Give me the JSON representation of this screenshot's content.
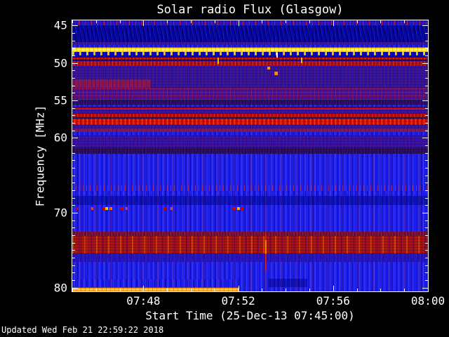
{
  "title": "Solar radio Flux (Glasgow)",
  "updated": "Updated Wed Feb 21 22:59:22 2018",
  "x_axis": {
    "label": "Start Time (25-Dec-13 07:45:00)",
    "minutes_total": 15,
    "major_ticks": [
      {
        "minute": 3,
        "label": "07:48"
      },
      {
        "minute": 7,
        "label": "07:52"
      },
      {
        "minute": 11,
        "label": "07:56"
      },
      {
        "minute": 15,
        "label": "08:00"
      }
    ]
  },
  "y_axis": {
    "label": "Frequency [MHz]",
    "major_ticks": [
      {
        "value": 45,
        "label": "45"
      },
      {
        "value": 50,
        "label": "50"
      },
      {
        "value": 55,
        "label": "55"
      },
      {
        "value": 60,
        "label": "60"
      },
      {
        "value": 70,
        "label": "70"
      },
      {
        "value": 80,
        "label": "80"
      }
    ],
    "minor_step_mhz": 1
  },
  "chart_data": {
    "type": "heatmap",
    "subtype": "radio-spectrogram",
    "title": "Solar radio Flux (Glasgow)",
    "xlabel": "Start Time (25-Dec-13 07:45:00)",
    "ylabel": "Frequency [MHz]",
    "x_range_time": [
      "07:45:00",
      "08:00:00"
    ],
    "y_range_mhz": [
      44.3,
      80.5
    ],
    "y_axis_direction": "increasing-downward",
    "grid": false,
    "legend": "none",
    "palette": {
      "background_quiet": "#1B1BE0",
      "weak": "#3D0F93",
      "moderate": "#BC0E0E",
      "strong": "#FF9800",
      "saturated": "#FFEE58",
      "frame_text": "#FFFFFF"
    },
    "bands": [
      {
        "name": "top-noise-row",
        "f0": 44.3,
        "f1": 45.0,
        "tex": "topnoise"
      },
      {
        "name": "quiet-navy",
        "f0": 45.0,
        "f1": 47.25,
        "tex": "navy"
      },
      {
        "name": "thin-purple-row",
        "f0": 47.25,
        "f1": 47.55,
        "tex": "mauve"
      },
      {
        "name": "pre-yellow-blue",
        "f0": 47.55,
        "f1": 47.9,
        "tex": "blue"
      },
      {
        "name": "saturated-yellow-band",
        "f0": 47.9,
        "f1": 48.55,
        "tex": "yellowband"
      },
      {
        "name": "comb-teeth-band",
        "f0": 48.55,
        "f1": 49.3,
        "tex": "teeth"
      },
      {
        "name": "red-line-49",
        "f0": 49.3,
        "f1": 49.55,
        "tex": "red"
      },
      {
        "name": "gap-navy",
        "f0": 49.55,
        "f1": 49.75,
        "tex": "navy"
      },
      {
        "name": "red-band-50",
        "f0": 49.75,
        "f1": 50.35,
        "tex": "red"
      },
      {
        "name": "purple-mottle-51",
        "f0": 50.35,
        "f1": 52.15,
        "tex": "purple"
      },
      {
        "name": "purple-52",
        "f0": 52.15,
        "f1": 53.35,
        "tex": "purple"
      },
      {
        "name": "red-patch-left-52",
        "f0": 52.15,
        "f1": 53.35,
        "tex": "redsoft",
        "x0": 0,
        "x1": 0.22
      },
      {
        "name": "purple-rows-54",
        "f0": 53.35,
        "f1": 54.9,
        "tex": "purplerows"
      },
      {
        "name": "dark-purple-55",
        "f0": 54.9,
        "f1": 55.55,
        "tex": "darkpurple"
      },
      {
        "name": "blue-row-556",
        "f0": 55.55,
        "f1": 55.85,
        "tex": "blue"
      },
      {
        "name": "red-rows-56",
        "f0": 55.85,
        "f1": 56.25,
        "tex": "redrows"
      },
      {
        "name": "purple-565",
        "f0": 56.25,
        "f1": 56.75,
        "tex": "purple"
      },
      {
        "name": "red-band-57",
        "f0": 56.75,
        "f1": 57.2,
        "tex": "red"
      },
      {
        "name": "dark-gap-572",
        "f0": 57.2,
        "f1": 57.45,
        "tex": "darkpurple"
      },
      {
        "name": "strong-red-58",
        "f0": 57.45,
        "f1": 58.3,
        "tex": "red2"
      },
      {
        "name": "purple-585",
        "f0": 58.3,
        "f1": 58.75,
        "tex": "purple"
      },
      {
        "name": "red-soft-59",
        "f0": 58.75,
        "f1": 59.25,
        "tex": "redsoft"
      },
      {
        "name": "blue-row-595",
        "f0": 59.25,
        "f1": 59.7,
        "tex": "blue"
      },
      {
        "name": "purple-60",
        "f0": 59.7,
        "f1": 60.15,
        "tex": "purple"
      },
      {
        "name": "purple-mottle-61",
        "f0": 60.15,
        "f1": 61.3,
        "tex": "purple"
      },
      {
        "name": "dark-rows-62",
        "f0": 61.3,
        "f1": 62.15,
        "tex": "darkpurple"
      },
      {
        "name": "quiet-blue-field",
        "f0": 62.15,
        "f1": 72.55,
        "tex": "bluefield"
      },
      {
        "name": "speckle-row-665",
        "f0": 66.3,
        "f1": 67.05,
        "tex": "speckrow"
      },
      {
        "name": "speckle-row-673",
        "f0": 67.05,
        "f1": 67.75,
        "tex": "specklow"
      },
      {
        "name": "darker-blue-68",
        "f0": 67.75,
        "f1": 68.95,
        "tex": "navyblue"
      },
      {
        "name": "maroon-band-73",
        "f0": 72.55,
        "f1": 73.1,
        "tex": "maroon"
      },
      {
        "name": "red-mottle-74",
        "f0": 73.1,
        "f1": 75.45,
        "tex": "redmottle"
      },
      {
        "name": "blue-purple-76",
        "f0": 75.45,
        "f1": 76.6,
        "tex": "bluepurple"
      },
      {
        "name": "quiet-blue-bottom",
        "f0": 76.6,
        "f1": 80.5,
        "tex": "bluefield"
      },
      {
        "name": "left-speckle-79",
        "f0": 78.95,
        "f1": 79.9,
        "tex": "specklow",
        "x0": 0,
        "x1": 0.47
      },
      {
        "name": "dark-patch-79",
        "f0": 78.8,
        "f1": 79.9,
        "tex": "navyblue",
        "x0": 0.55,
        "x1": 0.66
      },
      {
        "name": "orange-bottom-band",
        "f0": 79.9,
        "f1": 80.5,
        "tex": "orangeband",
        "x0": 0,
        "x1": 0.468
      }
    ],
    "features": [
      {
        "name": "vertical-burst-streak",
        "x": 0.545,
        "f0": 72.6,
        "f1": 77.8,
        "w": 2,
        "color": "#E01800",
        "core": "#FF8A00"
      },
      {
        "name": "orange-blob-505",
        "x": 0.553,
        "f0": 50.5,
        "f1": 50.9,
        "w": 4,
        "color": "#FF9800"
      },
      {
        "name": "orange-blob-512",
        "x": 0.572,
        "f0": 51.1,
        "f1": 51.6,
        "w": 5,
        "color": "#FF8C00"
      },
      {
        "name": "white-dash-49",
        "x": 0.575,
        "f0": 48.65,
        "f1": 49.3,
        "w": 2,
        "color": "#FFF3B0"
      },
      {
        "name": "long-tooth-1",
        "x": 0.41,
        "f0": 49.3,
        "f1": 50.1,
        "w": 2,
        "color": "#E6C800"
      },
      {
        "name": "long-tooth-2",
        "x": 0.645,
        "f0": 49.3,
        "f1": 50.0,
        "w": 2,
        "color": "#E6C800"
      },
      {
        "name": "dot-row-695-1",
        "x": 0.014,
        "f0": 69.2,
        "f1": 69.65,
        "w": 3,
        "color": "#D50000"
      },
      {
        "name": "dot-row-695-2",
        "x": 0.057,
        "f0": 69.2,
        "f1": 69.65,
        "w": 3,
        "color": "#E53935"
      },
      {
        "name": "dot-row-695-3",
        "x": 0.088,
        "f0": 69.2,
        "f1": 69.65,
        "w": 3,
        "color": "#D50000"
      },
      {
        "name": "dot-row-695-4",
        "x": 0.097,
        "f0": 69.2,
        "f1": 69.65,
        "w": 4,
        "color": "#FFD600"
      },
      {
        "name": "dot-row-695-5",
        "x": 0.108,
        "f0": 69.2,
        "f1": 69.65,
        "w": 4,
        "color": "#FF6D00"
      },
      {
        "name": "dot-row-695-6",
        "x": 0.14,
        "f0": 69.2,
        "f1": 69.65,
        "w": 3,
        "color": "#D50000"
      },
      {
        "name": "dot-row-695-7",
        "x": 0.152,
        "f0": 69.2,
        "f1": 69.65,
        "w": 3,
        "color": "#E53935"
      },
      {
        "name": "dot-row-695-8",
        "x": 0.262,
        "f0": 69.2,
        "f1": 69.65,
        "w": 3,
        "color": "#D50000"
      },
      {
        "name": "dot-row-695-9",
        "x": 0.28,
        "f0": 69.2,
        "f1": 69.65,
        "w": 3,
        "color": "#FF3D00"
      },
      {
        "name": "dot-row-695-10",
        "x": 0.455,
        "f0": 69.2,
        "f1": 69.65,
        "w": 4,
        "color": "#D50000"
      },
      {
        "name": "dot-row-695-11",
        "x": 0.468,
        "f0": 69.2,
        "f1": 69.65,
        "w": 4,
        "color": "#FFAB00"
      },
      {
        "name": "dot-row-695-12",
        "x": 0.478,
        "f0": 69.2,
        "f1": 69.65,
        "w": 3,
        "color": "#D50000"
      }
    ]
  }
}
